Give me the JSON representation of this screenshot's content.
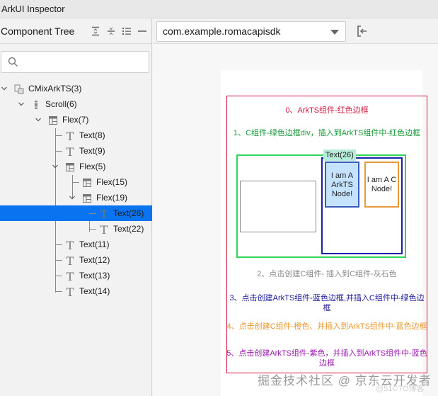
{
  "window": {
    "title": "ArkUI Inspector"
  },
  "left_panel": {
    "title": "Component Tree",
    "toolbar_icons": [
      "expand-all-icon",
      "collapse-all-icon",
      "list-icon",
      "minimize-icon"
    ],
    "search": {
      "placeholder": "",
      "value": ""
    },
    "tree": [
      {
        "label": "CMixArkTS(3)",
        "depth": 0,
        "expanded": true,
        "icon": "component-icon"
      },
      {
        "label": "Scroll(6)",
        "depth": 1,
        "expanded": true,
        "icon": "scroll-icon"
      },
      {
        "label": "Flex(7)",
        "depth": 2,
        "expanded": true,
        "icon": "flex-icon"
      },
      {
        "label": "Text(8)",
        "depth": 3,
        "icon": "text-icon"
      },
      {
        "label": "Text(9)",
        "depth": 3,
        "icon": "text-icon"
      },
      {
        "label": "Flex(5)",
        "depth": 3,
        "expanded": true,
        "icon": "flex-icon"
      },
      {
        "label": "Flex(15)",
        "depth": 4,
        "icon": "flex-icon"
      },
      {
        "label": "Flex(19)",
        "depth": 4,
        "expanded": true,
        "icon": "flex-icon"
      },
      {
        "label": "Text(26)",
        "depth": 5,
        "icon": "text-icon",
        "selected": true
      },
      {
        "label": "Text(22)",
        "depth": 5,
        "icon": "text-icon"
      },
      {
        "label": "Text(11)",
        "depth": 3,
        "icon": "text-icon"
      },
      {
        "label": "Text(12)",
        "depth": 3,
        "icon": "text-icon"
      },
      {
        "label": "Text(13)",
        "depth": 3,
        "icon": "text-icon"
      },
      {
        "label": "Text(14)",
        "depth": 3,
        "icon": "text-icon"
      }
    ]
  },
  "right_panel": {
    "app_selector": {
      "value": "com.example.romacapisdk"
    },
    "disconnect_icon": "exit-icon",
    "preview": {
      "texts": [
        {
          "text": "0、ArkTS组件-红色边框",
          "color": "#d6143c"
        },
        {
          "text": "1、C组件-绿色边框div，插入到ArkTS组件中-红色边框",
          "color": "#1a9a3a"
        },
        {
          "text": "2、点击创建C组件- 插入到C组件-灰石色",
          "color": "#8a8a8a"
        },
        {
          "text": "3、点击创建ArkTS组件-蓝色边框,并插入C组件中-绿色边框",
          "color": "#1a1a9a"
        },
        {
          "text": "4、点击创建C组件-橙色、并插入到ArkTS组件中-蓝色边框",
          "color": "#e8962a"
        },
        {
          "text": "5、点击创建ArkTS组件-紫色，并插入到ArkTS组件中-蓝色边框",
          "color": "#9a1ab0"
        }
      ],
      "arkts_node_text": "I am A ArkTS Node!",
      "c_node_text": "I am A C Node!",
      "selected_badge": "Text(26)"
    },
    "watermark": "掘金技术社区 @ 京东云开发者",
    "watermark2": "@51CTO博客"
  }
}
